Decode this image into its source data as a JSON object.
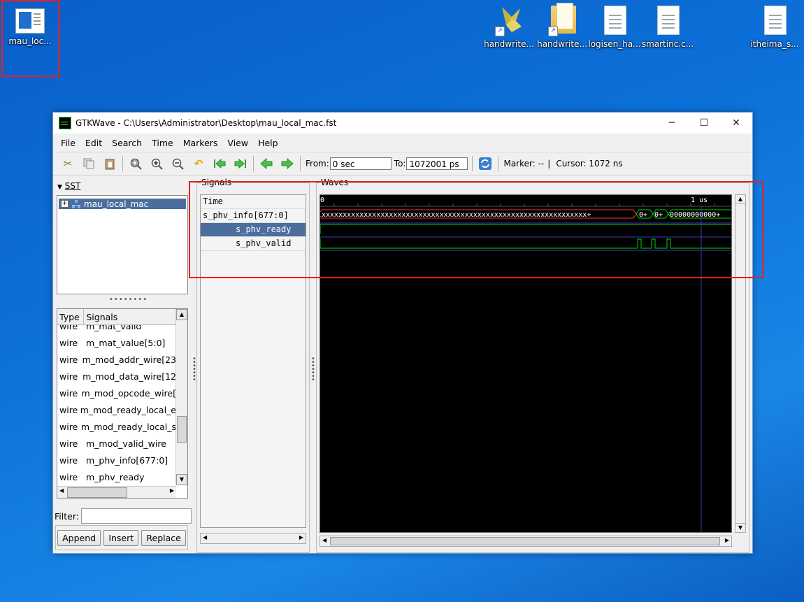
{
  "desktop": {
    "icons": [
      {
        "label": "mau_loc...",
        "kind": "app"
      },
      {
        "label": "handwrite...",
        "kind": "shortcut-app"
      },
      {
        "label": "handwrite...",
        "kind": "shortcut-folder"
      },
      {
        "label": "logisen_ha...",
        "kind": "file"
      },
      {
        "label": "smartinc.c...",
        "kind": "file"
      },
      {
        "label": "itheima_s...",
        "kind": "file"
      }
    ]
  },
  "window": {
    "title": "GTKWave - C:\\Users\\Administrator\\Desktop\\mau_local_mac.fst",
    "controls": {
      "minimize": "─",
      "maximize": "☐",
      "close": "✕"
    }
  },
  "menu": [
    "File",
    "Edit",
    "Search",
    "Time",
    "Markers",
    "View",
    "Help"
  ],
  "toolbar": {
    "from_label": "From:",
    "from_value": "0 sec",
    "to_label": "To:",
    "to_value": "1072001 ps",
    "marker_text": "Marker: --",
    "divider": "|",
    "cursor_text": "Cursor: 1072 ns"
  },
  "sst": {
    "header": "SST",
    "tree_item": "mau_local_mac"
  },
  "signal_list": {
    "col_type": "Type",
    "col_signals": "Signals",
    "rows": [
      {
        "type": "wire",
        "name": "m_mat_valid"
      },
      {
        "type": "wire",
        "name": "m_mat_value[5:0]"
      },
      {
        "type": "wire",
        "name": "m_mod_addr_wire[23"
      },
      {
        "type": "wire",
        "name": "m_mod_data_wire[12"
      },
      {
        "type": "wire",
        "name": "m_mod_opcode_wire["
      },
      {
        "type": "wire",
        "name": "m_mod_ready_local_e"
      },
      {
        "type": "wire",
        "name": "m_mod_ready_local_s"
      },
      {
        "type": "wire",
        "name": "m_mod_valid_wire"
      },
      {
        "type": "wire",
        "name": "m_phv_info[677:0]"
      },
      {
        "type": "wire",
        "name": "m_phv_ready"
      }
    ],
    "filter_label": "Filter:",
    "filter_value": "",
    "buttons": {
      "append": "Append",
      "insert": "Insert",
      "replace": "Replace"
    }
  },
  "signals_pane": {
    "title": "Signals",
    "items": [
      {
        "label": "Time"
      },
      {
        "label": "s_phv_info[677:0]"
      },
      {
        "label": "s_phv_ready"
      },
      {
        "label": "s_phv_valid"
      }
    ]
  },
  "waves_pane": {
    "title": "Waves",
    "time_labels": [
      "0",
      "1 us"
    ],
    "bus_segments": [
      "xxxxxxxxxxxxxxxxxxxxxxxxxxxxxxxxxxxxxxxxxxxxxxxxxxxxxxxxxxxxxxx+",
      "0+",
      "0+",
      "00000000000+"
    ],
    "colors": {
      "background": "#000000",
      "trace": "#00d800",
      "undefined": "#ff3030",
      "cursor": "#3a3ab8"
    }
  }
}
